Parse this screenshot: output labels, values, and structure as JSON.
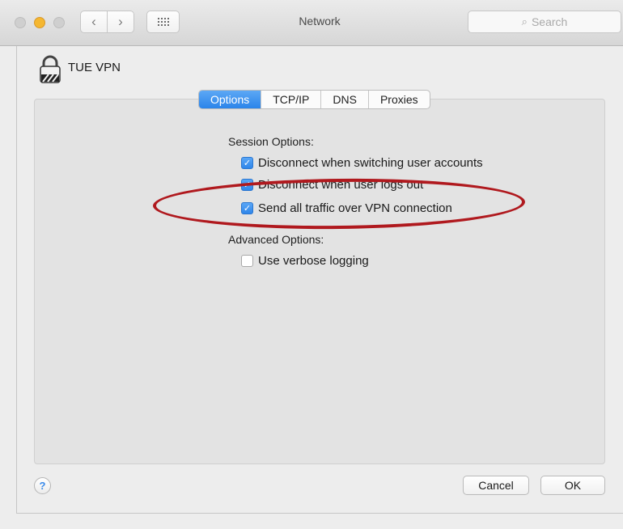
{
  "window": {
    "title": "Network",
    "search_placeholder": "Search",
    "nav": {
      "back": "‹",
      "forward": "›"
    }
  },
  "connection": {
    "name": "TUE VPN",
    "icon": "padlock-vpn-icon"
  },
  "tabs": [
    {
      "label": "Options",
      "active": true
    },
    {
      "label": "TCP/IP",
      "active": false
    },
    {
      "label": "DNS",
      "active": false
    },
    {
      "label": "Proxies",
      "active": false
    }
  ],
  "session": {
    "heading": "Session Options:",
    "options": [
      {
        "label": "Disconnect when switching user accounts",
        "checked": true
      },
      {
        "label": "Disconnect when user logs out",
        "checked": true
      },
      {
        "label": "Send all traffic over VPN connection",
        "checked": true
      }
    ]
  },
  "advanced": {
    "heading": "Advanced Options:",
    "options": [
      {
        "label": "Use verbose logging",
        "checked": false
      }
    ]
  },
  "footer": {
    "help": "?",
    "cancel": "Cancel",
    "ok": "OK"
  },
  "colors": {
    "accent": "#2f86ea",
    "annotation": "#b0191e",
    "minimize": "#f5b731"
  }
}
